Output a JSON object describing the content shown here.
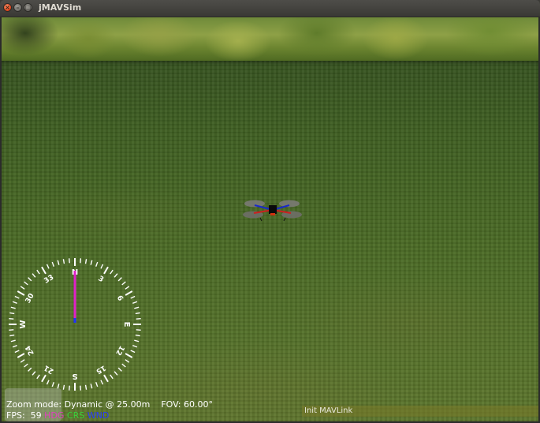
{
  "window": {
    "title": "jMAVSim"
  },
  "window_buttons": {
    "close": "×",
    "minimize": "–",
    "maximize": "□"
  },
  "hud": {
    "zoom_label": "Zoom mode:",
    "zoom_value": "Dynamic @ 25.00m",
    "fov_label": "FOV:",
    "fov_value": "60.00°",
    "fps_label": "FPS:",
    "fps_value": "59",
    "legend": {
      "hdg": "HDG",
      "crs": "CRS",
      "wnd": "WND"
    }
  },
  "status": {
    "text": "Init MAVLink"
  },
  "compass": {
    "cardinals": [
      "N",
      "E",
      "S",
      "W"
    ],
    "degree_labels": [
      "3",
      "6",
      "12",
      "15",
      "21",
      "24",
      "30",
      "33"
    ],
    "heading_deg": 0,
    "colors": {
      "ring": "#ffffff",
      "heading_needle": "#e020c8",
      "wind_marker": "#2030ff"
    }
  },
  "colors": {
    "grass": "#4a6a25",
    "titlebar": "#3c3b37",
    "status_bar": "#6e6e2c"
  },
  "icons": {
    "drone": "quadcopter-icon"
  }
}
